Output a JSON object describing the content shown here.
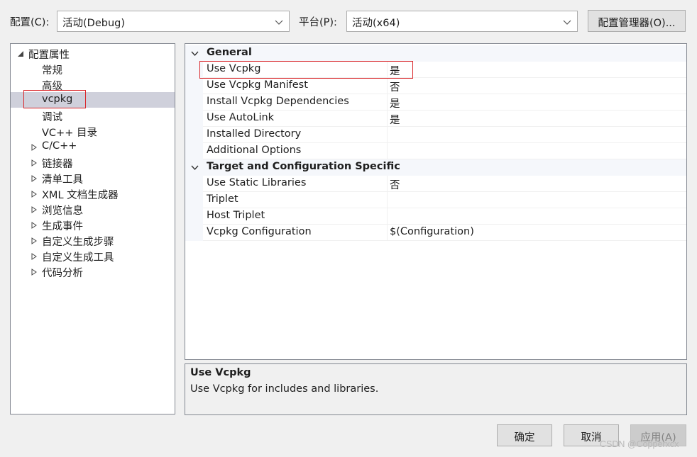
{
  "toolbar": {
    "config_label": "配置(C):",
    "config_value": "活动(Debug)",
    "platform_label": "平台(P):",
    "platform_value": "活动(x64)",
    "config_manager_label": "配置管理器(O)..."
  },
  "tree": {
    "root": "配置属性",
    "items": [
      {
        "label": "常规",
        "expandable": false
      },
      {
        "label": "高级",
        "expandable": false
      },
      {
        "label": "vcpkg",
        "expandable": false,
        "selected": true
      },
      {
        "label": "调试",
        "expandable": false
      },
      {
        "label": "VC++ 目录",
        "expandable": false
      },
      {
        "label": "C/C++",
        "expandable": true
      },
      {
        "label": "链接器",
        "expandable": true
      },
      {
        "label": "清单工具",
        "expandable": true
      },
      {
        "label": "XML 文档生成器",
        "expandable": true
      },
      {
        "label": "浏览信息",
        "expandable": true
      },
      {
        "label": "生成事件",
        "expandable": true
      },
      {
        "label": "自定义生成步骤",
        "expandable": true
      },
      {
        "label": "自定义生成工具",
        "expandable": true
      },
      {
        "label": "代码分析",
        "expandable": true
      }
    ]
  },
  "grid": {
    "categories": [
      {
        "name": "General",
        "rows": [
          {
            "name": "Use Vcpkg",
            "value": "是"
          },
          {
            "name": "Use Vcpkg Manifest",
            "value": "否"
          },
          {
            "name": "Install Vcpkg Dependencies",
            "value": "是"
          },
          {
            "name": "Use AutoLink",
            "value": "是"
          },
          {
            "name": "Installed Directory",
            "value": ""
          },
          {
            "name": "Additional Options",
            "value": ""
          }
        ]
      },
      {
        "name": "Target and Configuration Specific",
        "rows": [
          {
            "name": "Use Static Libraries",
            "value": "否"
          },
          {
            "name": "Triplet",
            "value": ""
          },
          {
            "name": "Host Triplet",
            "value": ""
          },
          {
            "name": "Vcpkg Configuration",
            "value": "$(Configuration)"
          }
        ]
      }
    ]
  },
  "description": {
    "title": "Use Vcpkg",
    "text": "Use Vcpkg for includes and libraries."
  },
  "buttons": {
    "ok": "确定",
    "cancel": "取消",
    "apply": "应用(A)"
  },
  "watermark": "CSDN @Copperxcx",
  "colors": {
    "highlight_box": "#d9262a",
    "selected_bg": "#cfd0db",
    "category_bg": "#f5f7fb"
  }
}
